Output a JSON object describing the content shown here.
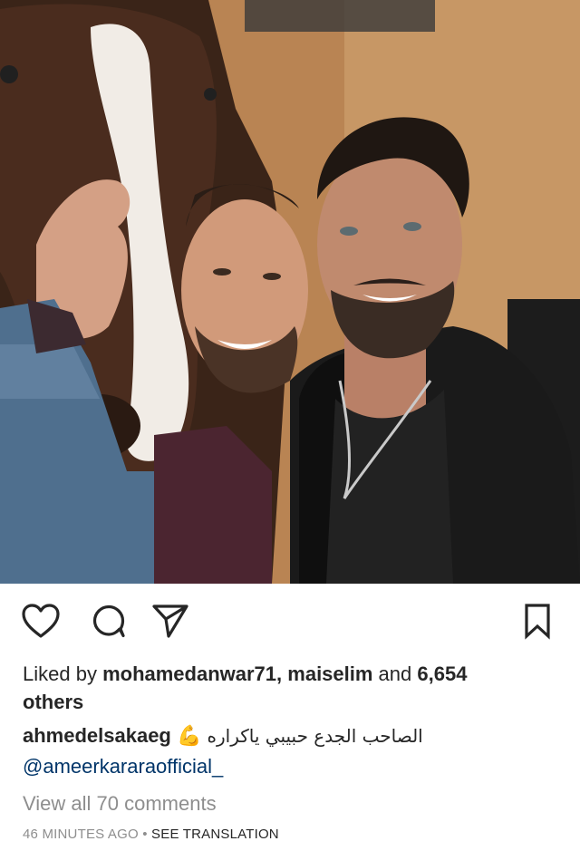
{
  "post": {
    "likes": {
      "prefix": "Liked by ",
      "user1": "mohamedanwar71",
      "sep": ", ",
      "user2": "maiselim",
      "and": " and ",
      "count": "6,654",
      "suffix": "others"
    },
    "caption": {
      "username": "ahmedelsakaeg",
      "emoji": "💪",
      "text": "الصاحب الجدع حبيبي ياكراره",
      "mention": "@ameerkararaofficial_"
    },
    "view_comments": "View all 70 comments",
    "timestamp": "46 MINUTES AGO",
    "dot": " • ",
    "see_translation": "SEE TRANSLATION"
  },
  "icons": {
    "like": "heart-icon",
    "comment": "comment-icon",
    "share": "paper-plane-icon",
    "save": "bookmark-icon"
  },
  "colors": {
    "text": "#262626",
    "muted": "#8e8e8e",
    "link": "#003569"
  }
}
